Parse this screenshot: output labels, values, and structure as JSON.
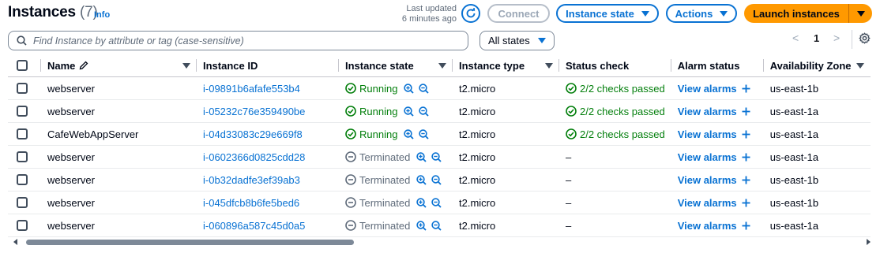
{
  "header": {
    "title": "Instances",
    "count": "(7)",
    "info": "Info",
    "last_updated_line1": "Last updated",
    "last_updated_line2": "6 minutes ago",
    "connect": "Connect",
    "instance_state": "Instance state",
    "actions": "Actions",
    "launch": "Launch instances"
  },
  "filter": {
    "placeholder": "Find Instance by attribute or tag (case-sensitive)",
    "states": "All states"
  },
  "pagination": {
    "prev": "<",
    "page": "1",
    "next": ">"
  },
  "columns": [
    "Name",
    "Instance ID",
    "Instance state",
    "Instance type",
    "Status check",
    "Alarm status",
    "Availability Zone"
  ],
  "rows": [
    {
      "name": "webserver",
      "id": "i-09891b6afafe553b4",
      "state": "Running",
      "type": "t2.micro",
      "status": "2/2 checks passed",
      "alarm": "View alarms",
      "zone": "us-east-1b"
    },
    {
      "name": "webserver",
      "id": "i-05232c76e359490be",
      "state": "Running",
      "type": "t2.micro",
      "status": "2/2 checks passed",
      "alarm": "View alarms",
      "zone": "us-east-1a"
    },
    {
      "name": "CafeWebAppServer",
      "id": "i-04d33083c29e669f8",
      "state": "Running",
      "type": "t2.micro",
      "status": "2/2 checks passed",
      "alarm": "View alarms",
      "zone": "us-east-1a"
    },
    {
      "name": "webserver",
      "id": "i-0602366d0825cdd28",
      "state": "Terminated",
      "type": "t2.micro",
      "status": "–",
      "alarm": "View alarms",
      "zone": "us-east-1a"
    },
    {
      "name": "webserver",
      "id": "i-0b32dadfe3ef39ab3",
      "state": "Terminated",
      "type": "t2.micro",
      "status": "–",
      "alarm": "View alarms",
      "zone": "us-east-1b"
    },
    {
      "name": "webserver",
      "id": "i-045dfcb8b6fe5bed6",
      "state": "Terminated",
      "type": "t2.micro",
      "status": "–",
      "alarm": "View alarms",
      "zone": "us-east-1b"
    },
    {
      "name": "webserver",
      "id": "i-060896a587c45d0a5",
      "state": "Terminated",
      "type": "t2.micro",
      "status": "–",
      "alarm": "View alarms",
      "zone": "us-east-1a"
    }
  ],
  "colors": {
    "accent": "#0972d3",
    "launch": "#ff9900",
    "running": "#037f0c",
    "terminated": "#5f6b7a"
  }
}
